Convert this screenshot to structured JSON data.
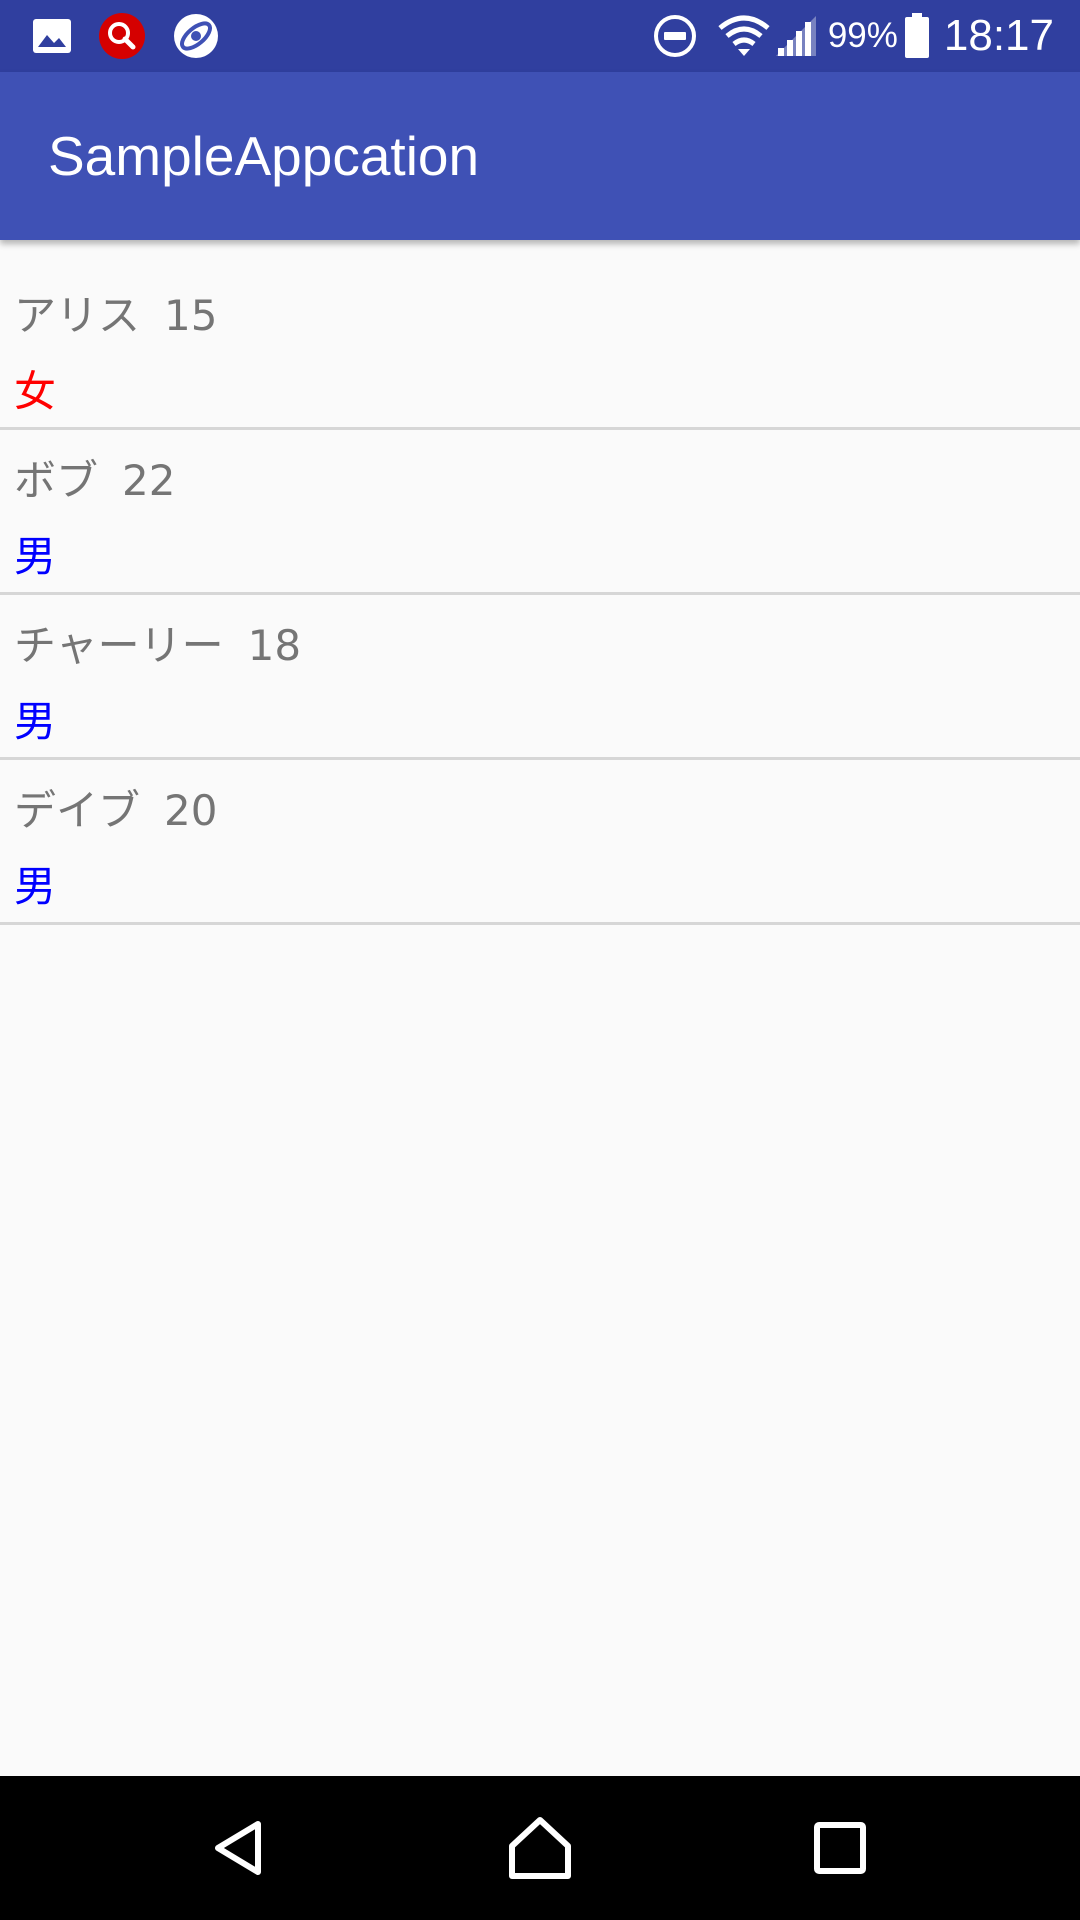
{
  "status_bar": {
    "battery_percent": "99%",
    "time": "18:17",
    "left_icons": [
      "gallery-icon",
      "search-app-icon",
      "app-logo-icon"
    ],
    "right_icons": [
      "do-not-disturb-icon",
      "wifi-icon",
      "cell-signal-icon",
      "battery-icon"
    ],
    "background_color": "#303f9f"
  },
  "app_bar": {
    "title": "SampleAppcation",
    "background_color": "#3f51b5"
  },
  "list": {
    "items": [
      {
        "name": "アリス",
        "age": "15",
        "gender": "女",
        "gender_color": "#ff0000"
      },
      {
        "name": "ボブ",
        "age": "22",
        "gender": "男",
        "gender_color": "#0000ff"
      },
      {
        "name": "チャーリー",
        "age": "18",
        "gender": "男",
        "gender_color": "#0000ff"
      },
      {
        "name": "デイブ",
        "age": "20",
        "gender": "男",
        "gender_color": "#0000ff"
      }
    ]
  },
  "nav_bar": {
    "buttons": [
      "back-icon",
      "home-icon",
      "recents-icon"
    ]
  }
}
